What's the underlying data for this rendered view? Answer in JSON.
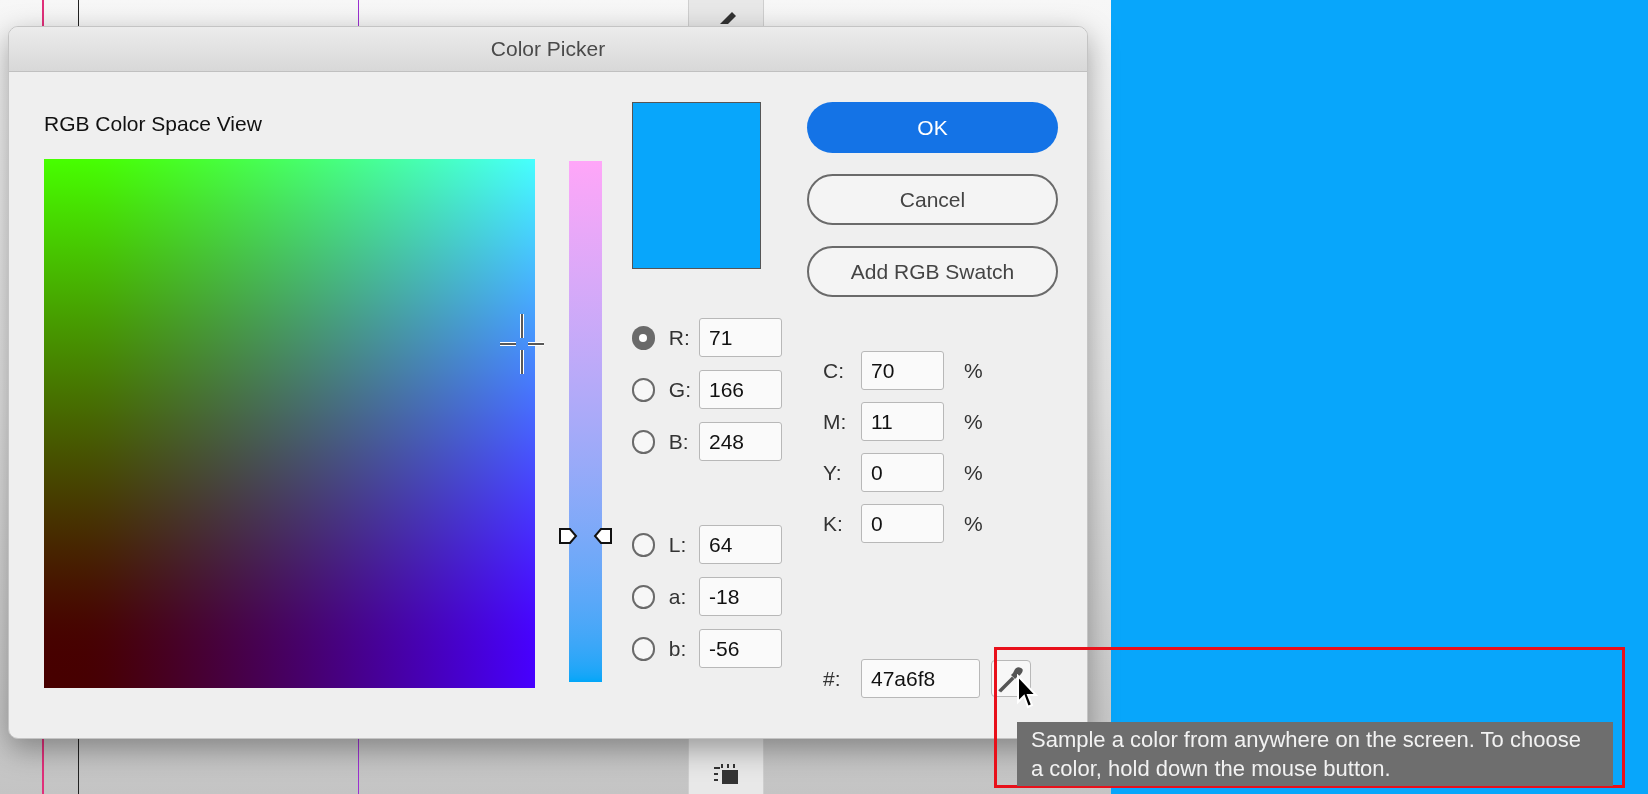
{
  "window": {
    "title": "Color Picker"
  },
  "heading": "RGB Color Space View",
  "slider": {
    "level": 0.28
  },
  "buttons": [
    {
      "label": "OK",
      "kind": "default"
    },
    {
      "label": "Cancel",
      "kind": "normal"
    },
    {
      "label": "Add RGB Swatch",
      "kind": "normal"
    }
  ],
  "rgb_fields": [
    {
      "label": "R:",
      "value": "71",
      "selected": true
    },
    {
      "label": "G:",
      "value": "166",
      "selected": false
    },
    {
      "label": "B:",
      "value": "248",
      "selected": false
    }
  ],
  "lab_fields": [
    {
      "label": "L:",
      "value": "64",
      "selected": false
    },
    {
      "label": "a:",
      "value": "-18",
      "selected": false
    },
    {
      "label": "b:",
      "value": "-56",
      "selected": false
    }
  ],
  "cmyk_fields": [
    {
      "label": "C:",
      "value": "70",
      "unit": "%"
    },
    {
      "label": "M:",
      "value": "11",
      "unit": "%"
    },
    {
      "label": "Y:",
      "value": "0",
      "unit": "%"
    },
    {
      "label": "K:",
      "value": "0",
      "unit": "%"
    }
  ],
  "hex_field": {
    "label": "#:",
    "value": "47a6f8"
  },
  "tooltip": "Sample a color from anywhere on the screen. To choose a color, hold down the mouse button."
}
